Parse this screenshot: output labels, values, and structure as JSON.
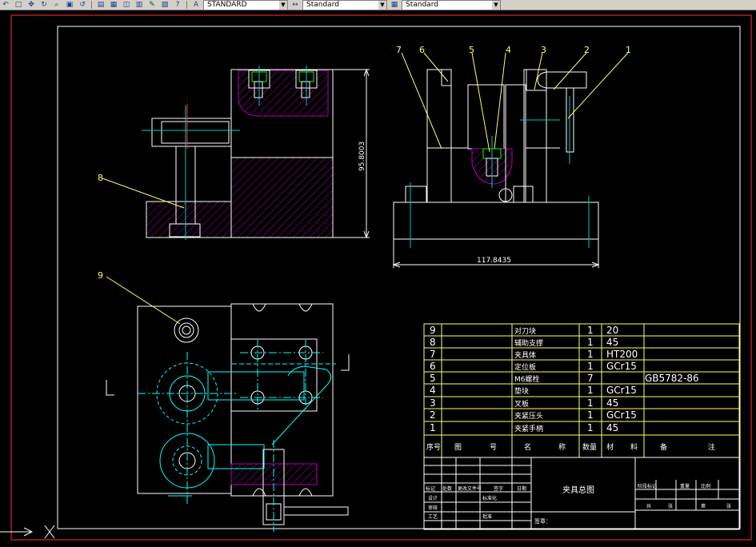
{
  "toolbar": {
    "text_style": "STANDARD",
    "dim_style": "Standard",
    "table_style": "Standard"
  },
  "dimensions": {
    "height": "95.8003",
    "width": "117.8435"
  },
  "balloons": [
    "1",
    "2",
    "3",
    "4",
    "5",
    "6",
    "7",
    "8",
    "9"
  ],
  "bom": {
    "rows": [
      {
        "no": "9",
        "name": "对刀块",
        "qty": "1",
        "mat": "20",
        "note": ""
      },
      {
        "no": "8",
        "name": "辅助支撑",
        "qty": "1",
        "mat": "45",
        "note": ""
      },
      {
        "no": "7",
        "name": "夹具体",
        "qty": "1",
        "mat": "HT200",
        "note": ""
      },
      {
        "no": "6",
        "name": "定位板",
        "qty": "1",
        "mat": "GCr15",
        "note": ""
      },
      {
        "no": "5",
        "name": "M6螺栓",
        "qty": "7",
        "mat": "",
        "note": "GB5782-86"
      },
      {
        "no": "4",
        "name": "垫块",
        "qty": "1",
        "mat": "GCr15",
        "note": ""
      },
      {
        "no": "3",
        "name": "叉板",
        "qty": "1",
        "mat": "45",
        "note": ""
      },
      {
        "no": "2",
        "name": "夹紧压头",
        "qty": "1",
        "mat": "GCr15",
        "note": ""
      },
      {
        "no": "1",
        "name": "夹紧手柄",
        "qty": "1",
        "mat": "45",
        "note": ""
      }
    ],
    "header": {
      "no": "序号",
      "code1": "图",
      "code2": "号",
      "name1": "名",
      "name2": "称",
      "qty": "数量",
      "mat1": "材",
      "mat2": "料",
      "note1": "备",
      "note2": "注"
    }
  },
  "title_block": {
    "drawing_name": "夹具总图",
    "mark": "标记",
    "count": "处数",
    "change_no": "更改文件号",
    "sign": "签字",
    "date": "日期",
    "design": "设计",
    "check": "审核",
    "process": "工艺",
    "standard": "标准化",
    "approve": "批准",
    "stage": "阶段标记",
    "weight": "重量",
    "ratio": "比例",
    "stamp": "签章：",
    "sheets": "共",
    "sheet": "张",
    "page": "第",
    "page_unit": "张"
  },
  "colors": {
    "line": "#ffffff",
    "center": "#00c8c8",
    "hatch": "#b000b0",
    "leader": "#ffff66",
    "border": "#ff3030",
    "table": "#ffff66",
    "cyan": "#00ffff"
  }
}
